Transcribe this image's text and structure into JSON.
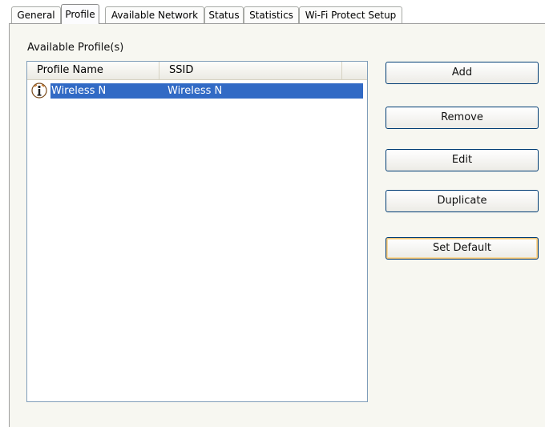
{
  "tabs": [
    {
      "label": "General",
      "active": false
    },
    {
      "label": "Profile",
      "active": true
    },
    {
      "label": "Available Network",
      "active": false
    },
    {
      "label": "Status",
      "active": false
    },
    {
      "label": "Statistics",
      "active": false
    },
    {
      "label": "Wi-Fi Protect Setup",
      "active": false
    }
  ],
  "profile_list": {
    "label": "Available Profile(s)",
    "columns": [
      "Profile Name",
      "SSID"
    ],
    "rows": [
      {
        "profile_name": "Wireless N",
        "ssid": "Wireless N",
        "icon": "infrastructure-profile-icon",
        "selected": true
      }
    ]
  },
  "buttons": {
    "add": "Add",
    "remove": "Remove",
    "edit": "Edit",
    "duplicate": "Duplicate",
    "set_default": "Set Default"
  },
  "colors": {
    "selection": "#316ac5",
    "panel": "#f7f7f1",
    "button_border": "#003c74"
  }
}
